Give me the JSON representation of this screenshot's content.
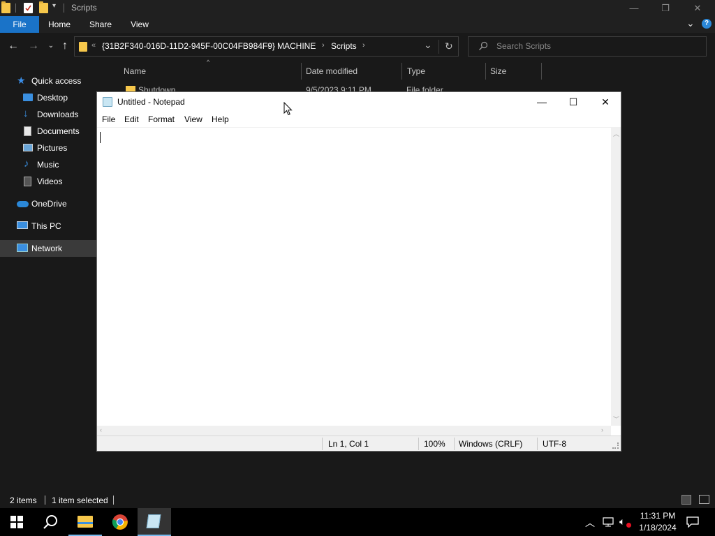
{
  "explorer": {
    "title": "Scripts",
    "ribbon_tabs": [
      "File",
      "Home",
      "Share",
      "View"
    ],
    "address": {
      "overflow": "«",
      "crumbs": [
        "{31B2F340-016D-11D2-945F-00C04FB984F9}",
        "MACHINE",
        "Scripts"
      ]
    },
    "search_placeholder": "Search Scripts",
    "sidebar": {
      "items": [
        {
          "label": "Quick access",
          "icon": "star-icon"
        },
        {
          "label": "Desktop",
          "icon": "desktop-icon"
        },
        {
          "label": "Downloads",
          "icon": "download-icon"
        },
        {
          "label": "Documents",
          "icon": "documents-icon"
        },
        {
          "label": "Pictures",
          "icon": "pictures-icon"
        },
        {
          "label": "Music",
          "icon": "music-icon"
        },
        {
          "label": "Videos",
          "icon": "videos-icon"
        },
        {
          "label": "OneDrive",
          "icon": "cloud-icon"
        },
        {
          "label": "This PC",
          "icon": "computer-icon"
        },
        {
          "label": "Network",
          "icon": "network-icon"
        }
      ]
    },
    "columns": [
      "Name",
      "Date modified",
      "Type",
      "Size"
    ],
    "files": [
      {
        "name": "Shutdown",
        "date": "9/5/2023 9:11 PM",
        "type": "File folder"
      }
    ],
    "status": {
      "items": "2 items",
      "selected": "1 item selected"
    }
  },
  "notepad": {
    "title": "Untitled - Notepad",
    "menu": [
      "File",
      "Edit",
      "Format",
      "View",
      "Help"
    ],
    "content": "",
    "status": {
      "position": "Ln 1, Col 1",
      "zoom": "100%",
      "line_endings": "Windows (CRLF)",
      "encoding": "UTF-8"
    }
  },
  "taskbar": {
    "time": "11:31 PM",
    "date": "1/18/2024"
  },
  "colors": {
    "accent": "#1a73c8",
    "folder": "#f6c74b",
    "taskbar_active_indicator": "#76b9ed"
  }
}
